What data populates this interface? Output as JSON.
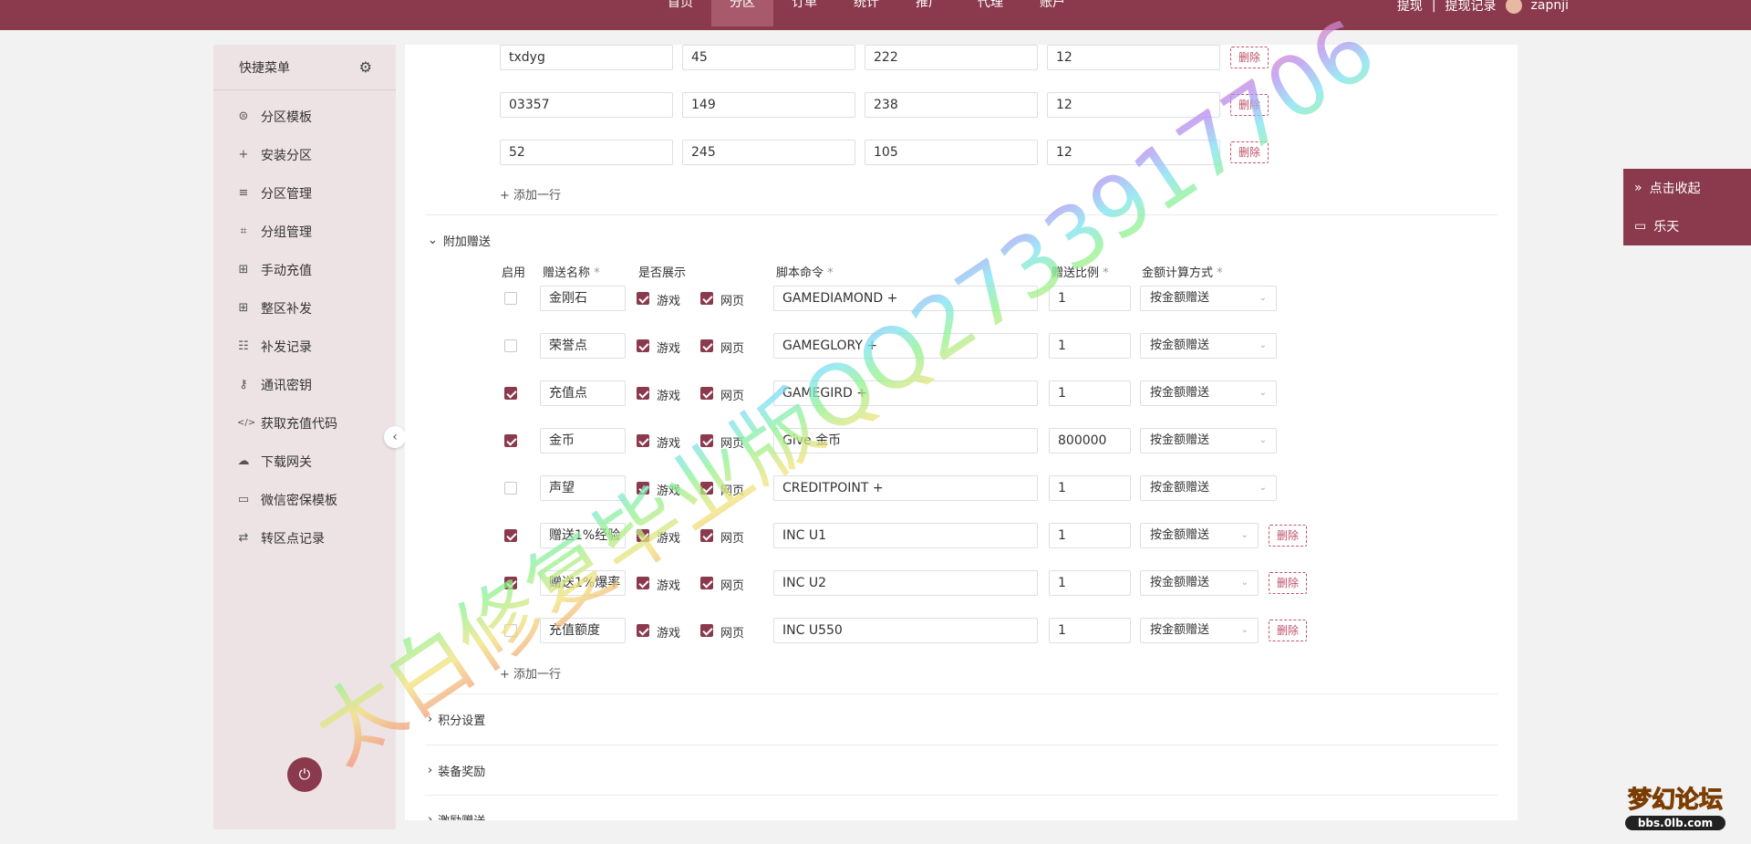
{
  "topnav": {
    "items": [
      "首页",
      "分区",
      "订单",
      "统计",
      "推广",
      "代理",
      "账户"
    ],
    "active_index": 1,
    "right": {
      "withdraw": "提现",
      "separator": "|",
      "withdraw_record": "提现记录",
      "username": "zapnji"
    }
  },
  "sidebar": {
    "title": "快捷菜单",
    "items": [
      {
        "label": "分区模板",
        "icon": "gamepad-icon"
      },
      {
        "label": "安装分区",
        "icon": "plus-icon"
      },
      {
        "label": "分区管理",
        "icon": "list-icon"
      },
      {
        "label": "分组管理",
        "icon": "group-icon"
      },
      {
        "label": "手动充值",
        "icon": "grid-icon"
      },
      {
        "label": "整区补发",
        "icon": "apps-icon"
      },
      {
        "label": "补发记录",
        "icon": "record-icon"
      },
      {
        "label": "通讯密钥",
        "icon": "key-icon"
      },
      {
        "label": "获取充值代码",
        "icon": "code-icon"
      },
      {
        "label": "下载网关",
        "icon": "cloud-download-icon"
      },
      {
        "label": "微信密保模板",
        "icon": "card-icon"
      },
      {
        "label": "转区点记录",
        "icon": "transfer-icon"
      }
    ]
  },
  "top_rows": [
    {
      "c1": "txdyg",
      "c2": "45",
      "c3": "222",
      "c4": "12"
    },
    {
      "c1": "03357",
      "c2": "149",
      "c3": "238",
      "c4": "12"
    },
    {
      "c1": "52",
      "c2": "245",
      "c3": "105",
      "c4": "12"
    }
  ],
  "delete_label": "删除",
  "add_row_label": "+ 添加一行",
  "gift_section": {
    "title": "附加赠送",
    "headers": {
      "enable": "启用",
      "name": "赠送名称",
      "show": "是否展示",
      "script": "脚本命令",
      "ratio": "赠送比例",
      "calc": "金额计算方式",
      "required_mark": "*"
    },
    "game_label": "游戏",
    "web_label": "网页",
    "rows": [
      {
        "enabled": false,
        "name": "金刚石",
        "game": true,
        "web": true,
        "script": "GAMEDIAMOND +",
        "ratio": "1",
        "calc": "按金额赠送",
        "deletable": false
      },
      {
        "enabled": false,
        "name": "荣誉点",
        "game": true,
        "web": true,
        "script": "GAMEGLORY +",
        "ratio": "1",
        "calc": "按金额赠送",
        "deletable": false
      },
      {
        "enabled": true,
        "name": "充值点",
        "game": true,
        "web": true,
        "script": "GAMEGIRD +",
        "ratio": "1",
        "calc": "按金额赠送",
        "deletable": false
      },
      {
        "enabled": true,
        "name": "金币",
        "game": true,
        "web": true,
        "script": "Give 金币",
        "ratio": "800000",
        "calc": "按金额赠送",
        "deletable": false
      },
      {
        "enabled": false,
        "name": "声望",
        "game": true,
        "web": true,
        "script": "CREDITPOINT +",
        "ratio": "1",
        "calc": "按金额赠送",
        "deletable": false
      },
      {
        "enabled": true,
        "name": "赠送1%经验",
        "game": true,
        "web": true,
        "script": "INC U1",
        "ratio": "1",
        "calc": "按金额赠送",
        "deletable": true
      },
      {
        "enabled": true,
        "name": "赠送1%爆率",
        "game": true,
        "web": true,
        "script": "INC U2",
        "ratio": "1",
        "calc": "按金额赠送",
        "deletable": true
      },
      {
        "enabled": false,
        "name": "充值额度",
        "game": true,
        "web": true,
        "script": "INC U550",
        "ratio": "1",
        "calc": "按金额赠送",
        "deletable": true
      }
    ]
  },
  "collapsed_sections": [
    "积分设置",
    "装备奖励",
    "激励赠送"
  ],
  "float_panel": {
    "collapse": "点击收起",
    "chat": "乐天"
  },
  "watermark": {
    "line1": "太白修复毕业版QQ2733917706"
  },
  "logo": {
    "text": "梦幻论坛",
    "url_text": "bbs.0lb.com"
  },
  "colors": {
    "brand": "#8b3a4d",
    "sidebar_bg": "#ede3e5",
    "delete": "#c0506a"
  }
}
